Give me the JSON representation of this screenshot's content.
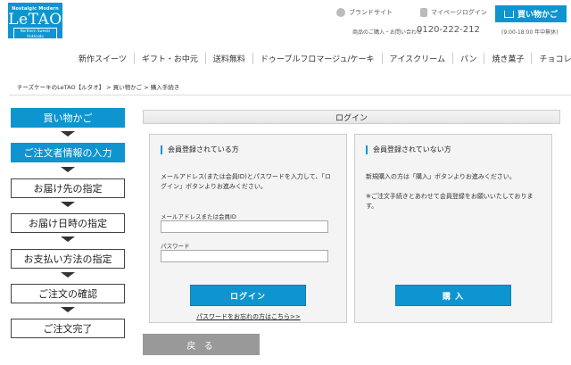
{
  "logo": {
    "tagline": "Nostalgic Modern",
    "name": "LeTAO",
    "subtitle": "Northern Sweets Hokkaido"
  },
  "header": {
    "brand_site": "ブランドサイト",
    "my_page_login": "マイページログイン",
    "cart_button": "買い物かご",
    "contact_label": "商品のご購入・お問い合わせ",
    "phone": "0120-222-212",
    "hours": "(9:00-18:00 年中無休)"
  },
  "nav": [
    "新作スイーツ",
    "ギフト・お中元",
    "送料無料",
    "ドゥーブルフロマージュ/ケーキ",
    "アイスクリーム",
    "パン",
    "焼き菓子",
    "チョコレート"
  ],
  "breadcrumb": "チーズケーキのLeTAO【ルタオ】 > 買い物かご > 購入手続き",
  "steps": [
    {
      "label": "買い物かご",
      "active": true
    },
    {
      "label": "ご注文者情報の入力",
      "active": true
    },
    {
      "label": "お届け先の指定",
      "active": false
    },
    {
      "label": "お届け日時の指定",
      "active": false
    },
    {
      "label": "お支払い方法の指定",
      "active": false
    },
    {
      "label": "ご注文の確認",
      "active": false
    },
    {
      "label": "ご注文完了",
      "active": false
    }
  ],
  "login": {
    "bar_title": "ログイン",
    "member": {
      "title": "会員登録されている方",
      "instructions_line1": "メールアドレス(または会員ID)とパスワードを入力して、「ロ",
      "instructions_line2": "グイン」ボタンよりお進みください。",
      "email_label": "メールアドレスまたは会員ID",
      "password_label": "パスワード",
      "login_button": "ログイン",
      "forgot_link": "パスワードをお忘れの方はこちら>>"
    },
    "guest": {
      "title": "会員登録されていない方",
      "line1": "新規購入の方は「購入」ボタンよりお進みください。",
      "line2": "※ご注文手続きとあわせて会員登録をお願いいたしておりま",
      "line3": "す。",
      "purchase_button": "購 入"
    }
  },
  "back_button": "戻 る"
}
